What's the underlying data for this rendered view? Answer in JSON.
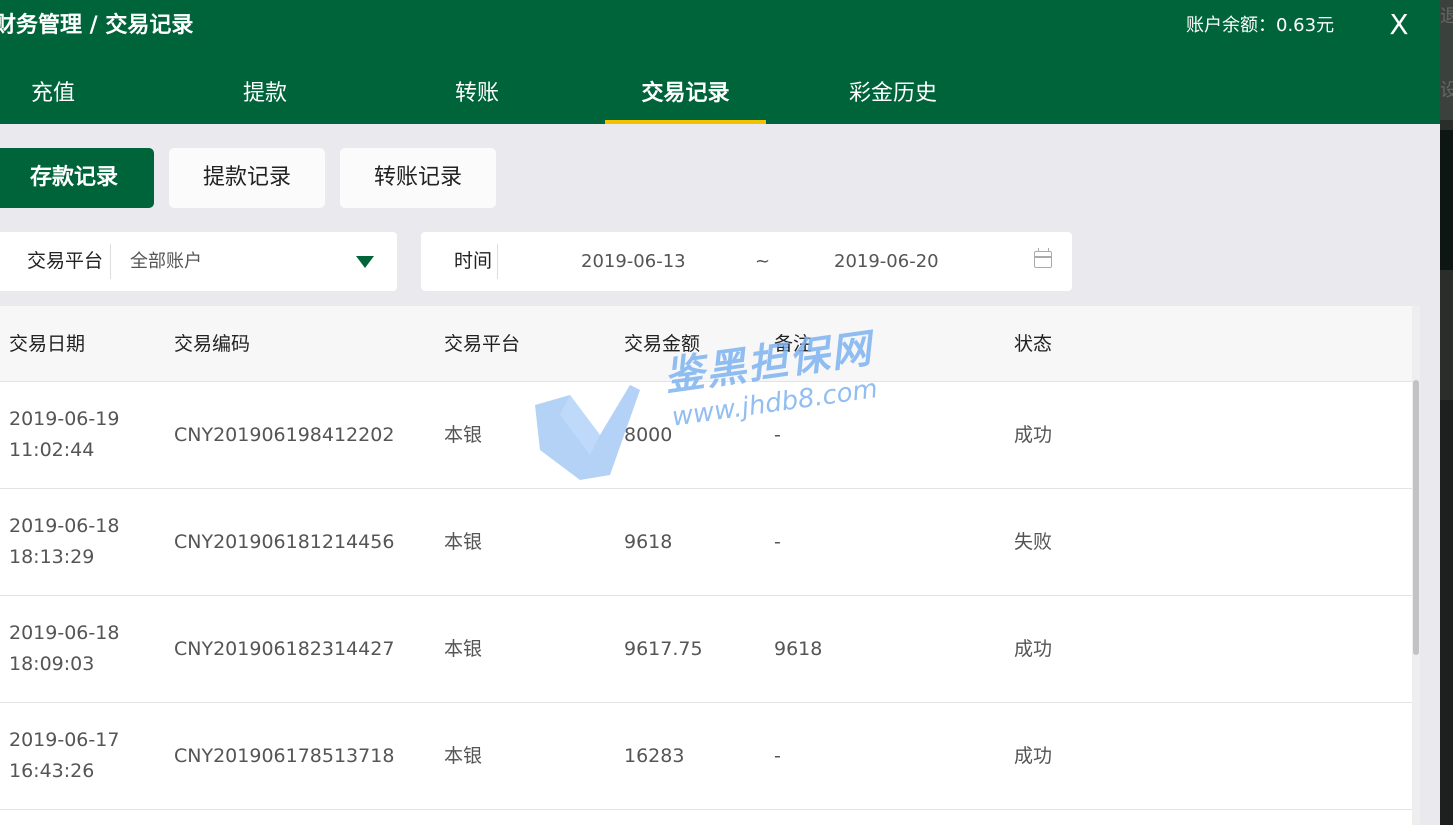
{
  "header": {
    "title": "财务管理 / 交易记录",
    "balance": "账户余额：0.63元",
    "close_label": "X"
  },
  "tabs": [
    {
      "label": "充值",
      "active": false
    },
    {
      "label": "提款",
      "active": false
    },
    {
      "label": "转账",
      "active": false
    },
    {
      "label": "交易记录",
      "active": true
    },
    {
      "label": "彩金历史",
      "active": false
    }
  ],
  "subtabs": [
    {
      "label": "存款记录",
      "active": true
    },
    {
      "label": "提款记录",
      "active": false
    },
    {
      "label": "转账记录",
      "active": false
    }
  ],
  "filters": {
    "platform_label": "交易平台",
    "platform_value": "全部账户",
    "time_label": "时间",
    "start_date": "2019-06-13",
    "range_sep": "~",
    "end_date": "2019-06-20"
  },
  "table": {
    "headers": [
      "交易日期",
      "交易编码",
      "交易平台",
      "交易金额",
      "备注",
      "状态"
    ],
    "rows": [
      {
        "date": "2019-06-19",
        "time": "11:02:44",
        "code": "CNY201906198412202",
        "platform": "本银",
        "amount": "8000",
        "note": "-",
        "status": "成功"
      },
      {
        "date": "2019-06-18",
        "time": "18:13:29",
        "code": "CNY201906181214456",
        "platform": "本银",
        "amount": "9618",
        "note": "-",
        "status": "失败"
      },
      {
        "date": "2019-06-18",
        "time": "18:09:03",
        "code": "CNY201906182314427",
        "platform": "本银",
        "amount": "9617.75",
        "note": "9618",
        "status": "成功"
      },
      {
        "date": "2019-06-17",
        "time": "16:43:26",
        "code": "CNY201906178513718",
        "platform": "本银",
        "amount": "16283",
        "note": "-",
        "status": "成功"
      }
    ]
  },
  "watermark": {
    "name": "鉴黑担保网",
    "url": "www.jhdb8.com"
  },
  "background": {
    "char1": "退",
    "char2": "设"
  },
  "colors": {
    "brand_green": "#00643b",
    "tab_indicator": "#f2c200",
    "panel_bg": "#eae9ee"
  }
}
